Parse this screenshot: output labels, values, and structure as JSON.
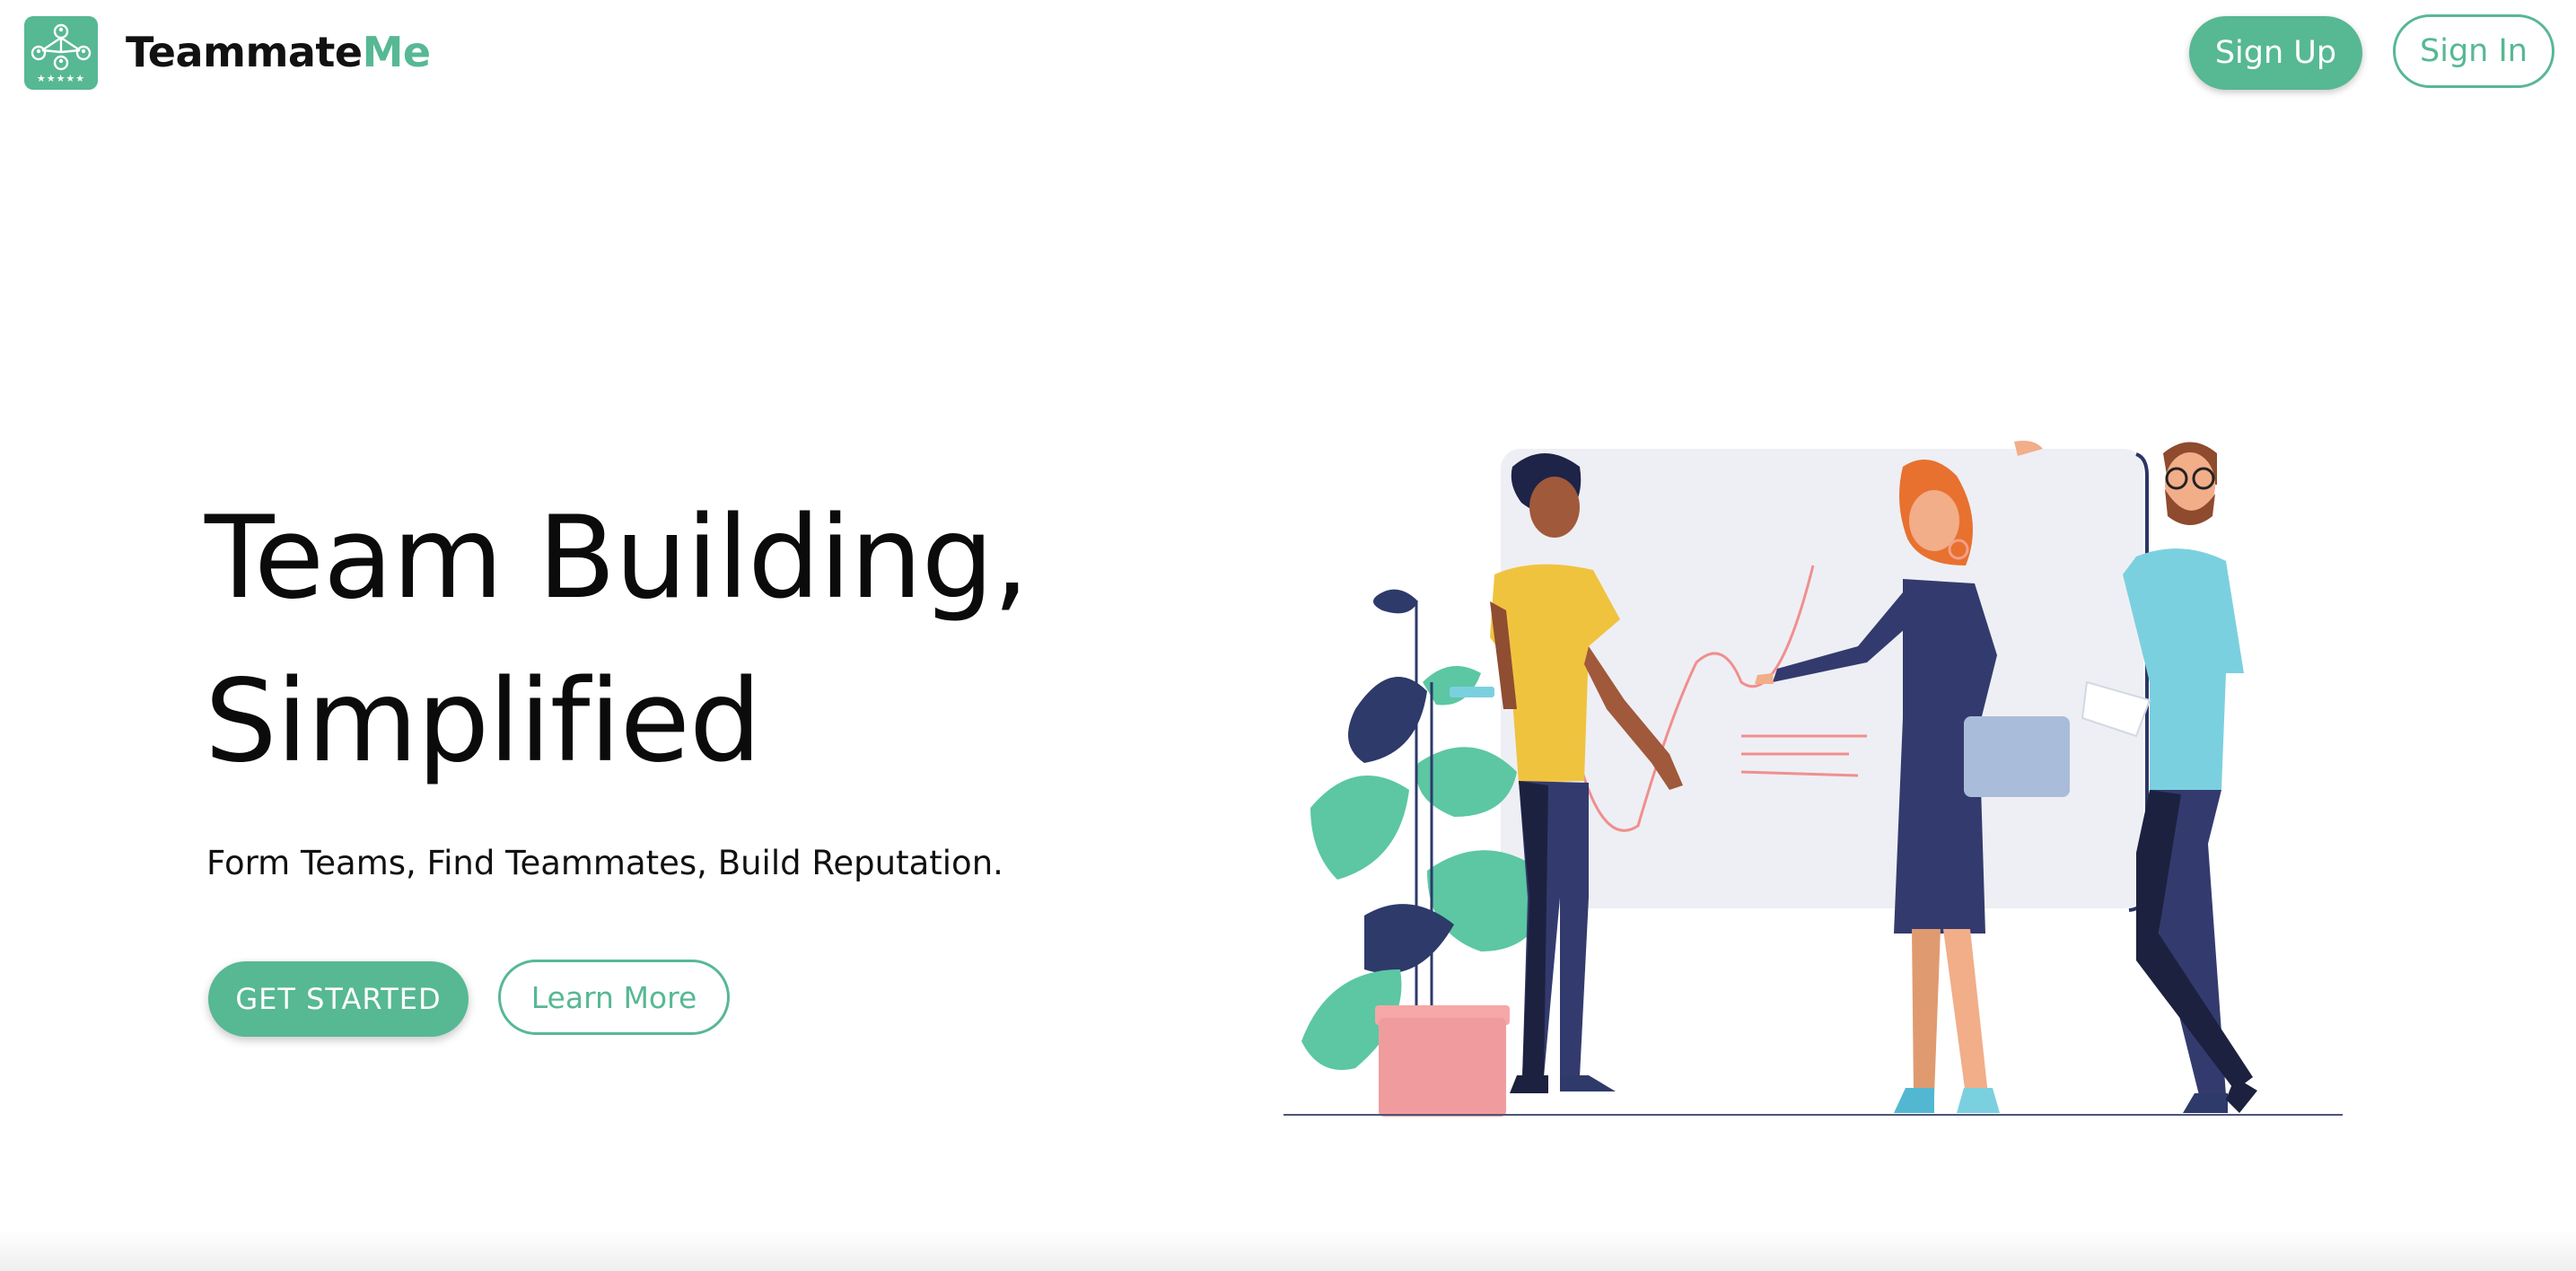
{
  "header": {
    "brand_main": "Teammate",
    "brand_accent": "Me",
    "logo_icon": "team-network-icon",
    "signup_label": "Sign Up",
    "signin_label": "Sign In"
  },
  "hero": {
    "title_line1": "Team Building,",
    "title_line2": "Simplified",
    "subtitle": "Form Teams, Find Teammates, Build Reputation.",
    "cta_primary": "GET STARTED",
    "cta_secondary": "Learn More"
  },
  "illustration": {
    "icon": "team-whiteboard-illustration"
  },
  "colors": {
    "accent": "#57b894",
    "text": "#111111",
    "background": "#ffffff"
  }
}
